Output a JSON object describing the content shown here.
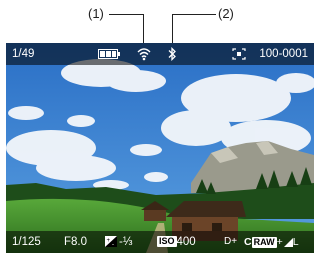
{
  "callouts": {
    "one": "(1)",
    "two": "(2)"
  },
  "top": {
    "image_number": "1/49",
    "folder_file": "100-0001",
    "icons": [
      "battery-icon",
      "wifi-icon",
      "bluetooth-icon",
      "protect-icon"
    ]
  },
  "bottom": {
    "shutter": "1/125",
    "aperture": "F8.0",
    "exposure_comp": "-⅓",
    "iso_label": "ISO",
    "iso_value": "400",
    "d_plus": "D+",
    "quality_c": "C",
    "raw": "RAW",
    "quality_suffix": "+",
    "size_l": "L"
  },
  "colors": {
    "sky": "#3a7fd0",
    "grass": "#3f8f2c",
    "overlay_bar": "#000000"
  }
}
